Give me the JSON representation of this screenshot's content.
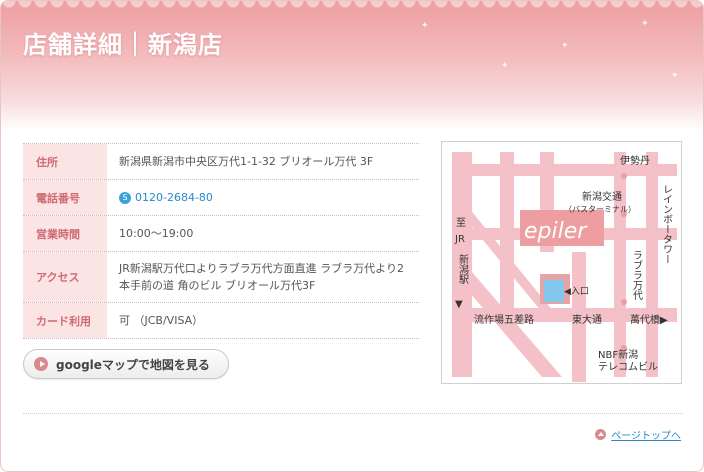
{
  "header": {
    "title": "店舗詳細｜新潟店"
  },
  "info": {
    "rows": [
      {
        "label": "住所",
        "value": "新潟県新潟市中央区万代1-1-32 ブリオール万代 3F"
      },
      {
        "label": "電話番号",
        "value": "0120-2684-80"
      },
      {
        "label": "営業時間",
        "value": "10:00〜19:00"
      },
      {
        "label": "アクセス",
        "value": "JR新潟駅万代口よりラブラ万代方面直進 ラブラ万代より2本手前の道 角のビル ブリオール万代3F"
      },
      {
        "label": "カード利用",
        "value": "可 （JCB/VISA）"
      }
    ]
  },
  "map_button": {
    "label": "googleマップで地図を見る"
  },
  "map": {
    "labels": {
      "isetan": "伊勢丹",
      "bus_terminal_1": "新潟交通",
      "bus_terminal_2": "（バスターミナル）",
      "rainbow_tower": "レインボータワー",
      "brand": "epiler",
      "entrance": "◀入口",
      "station_1": "至",
      "station_2": "JR",
      "station_3": "新潟駅",
      "lovela": "ラブラ万代",
      "ryusakuba": "流作場五差路",
      "higashi": "東大通",
      "bandaibashi": "萬代橋▶",
      "nbf_1": "NBF新潟",
      "nbf_2": "テレコムビル"
    }
  },
  "footer": {
    "pagetop_label": "ページトップへ"
  },
  "colors": {
    "accent": "#d06a74",
    "link": "#2a88c8",
    "road": "#f3c1c7",
    "label_bg": "#fbe4e4"
  }
}
